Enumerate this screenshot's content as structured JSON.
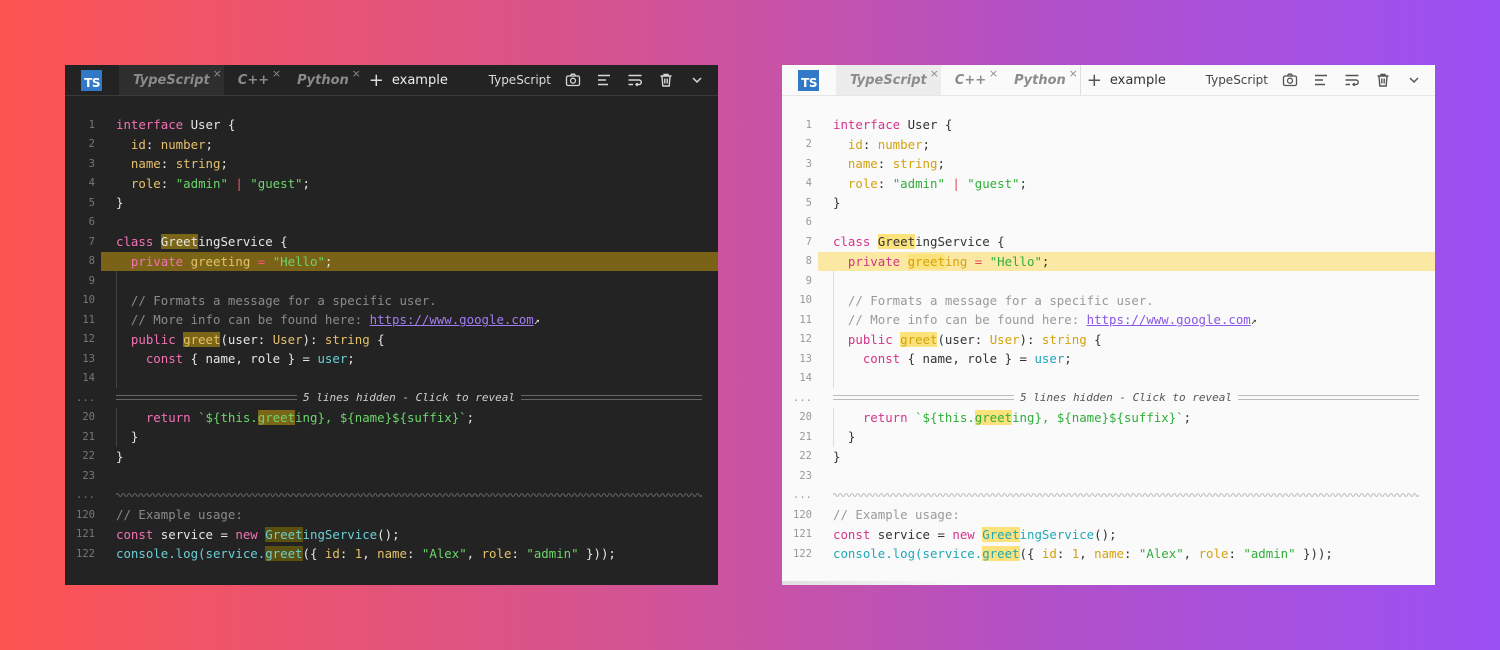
{
  "colors": {
    "ts_logo": "#3178c6",
    "dark_bg": "#232323",
    "light_bg": "#fafafa",
    "highlight_dark": "#7a6216",
    "highlight_light": "#fbe9a3"
  },
  "toolbar": {
    "logo_text": "TS",
    "tabs": [
      {
        "label": "TypeScript",
        "close": "×"
      },
      {
        "label": "C++",
        "close": "×"
      },
      {
        "label": "Python",
        "close": "×"
      }
    ],
    "add": "+",
    "filename": "example",
    "language": "TypeScript",
    "icons": [
      "camera-icon",
      "format-icon",
      "wrap-icon",
      "trash-icon",
      "chevron-down-icon"
    ]
  },
  "hidden_message": "5 lines hidden - Click to reveal",
  "ellipsis": "...",
  "line_numbers": [
    "1",
    "2",
    "3",
    "4",
    "5",
    "6",
    "7",
    "8",
    "9",
    "10",
    "11",
    "12",
    "13",
    "14",
    "20",
    "21",
    "22",
    "23",
    "120",
    "121",
    "122"
  ],
  "code": {
    "l1": [
      "interface",
      " User {"
    ],
    "l2": [
      "  ",
      "id",
      ": ",
      "number",
      ";"
    ],
    "l3": [
      "  ",
      "name",
      ": ",
      "string",
      ";"
    ],
    "l4": [
      "  ",
      "role",
      ": ",
      "\"admin\"",
      " | ",
      "\"guest\"",
      ";"
    ],
    "l5": [
      "}"
    ],
    "l7": [
      "class",
      " ",
      "Greet",
      "ingService {"
    ],
    "l8": [
      "  ",
      "private",
      " ",
      "greet",
      "ing",
      " = ",
      "\"Hello\"",
      ";"
    ],
    "l10": [
      "  // Formats a message for a specific user."
    ],
    "l11": [
      "  // More info can be found here: ",
      "https://www.google.com"
    ],
    "l12": [
      "  ",
      "public",
      " ",
      "greet",
      "(user: ",
      "User",
      "): ",
      "string",
      " {"
    ],
    "l13": [
      "    ",
      "const",
      " { name, role } = ",
      "user",
      ";"
    ],
    "l20": [
      "    ",
      "return",
      " `${this.",
      "greet",
      "ing}, ${name}${suffix}`",
      ";"
    ],
    "l21": [
      "  }"
    ],
    "l22": [
      "}"
    ],
    "l120": [
      "// Example usage:"
    ],
    "l121": [
      "const",
      " service = ",
      "new",
      " ",
      "Greet",
      "ingService",
      "();"
    ],
    "l122": [
      "console.log(service.",
      "greet",
      "({ ",
      "id",
      ": ",
      "1",
      ", ",
      "name",
      ": ",
      "\"Alex\"",
      ", ",
      "role",
      ": ",
      "\"admin\"",
      " }));"
    ]
  }
}
